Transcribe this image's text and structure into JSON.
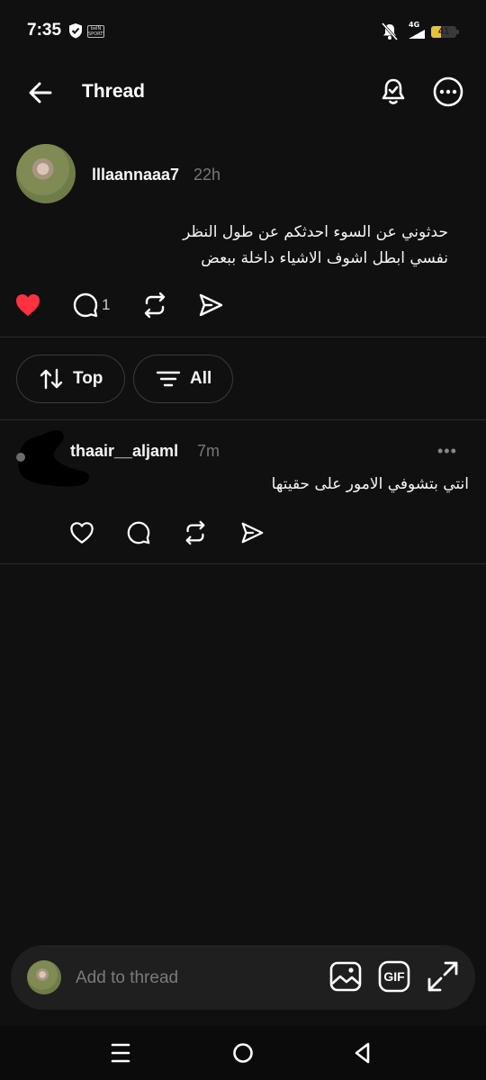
{
  "status_bar": {
    "time": "7:35",
    "app_badge": "beIN SPORTS",
    "network": "4G",
    "battery_level": "41",
    "battery_percent": 41,
    "battery_color": "#e7c13a"
  },
  "header": {
    "title": "Thread"
  },
  "post": {
    "username": "lllaannaaa7",
    "time": "22h",
    "text_line1": "حدثوني عن السوء احدثكم عن طول النظر",
    "text_line2": "نفسي ابطل اشوف الاشياء داخلة ببعض",
    "liked": true,
    "like_color": "#ff3040",
    "comment_count": "1"
  },
  "filters": {
    "sort_label": "Top",
    "filter_label": "All"
  },
  "reply": {
    "username": "thaair__aljaml",
    "time": "7m",
    "more_label": "•••",
    "text": "انتي بتشوفي الامور على حقيتها"
  },
  "composer": {
    "placeholder": "Add to thread",
    "gif_label": "GIF"
  },
  "icons": {
    "back": "arrow-left-icon",
    "notify": "bell-icon",
    "more": "more-horizontal-icon",
    "like": "heart-icon",
    "comment": "comment-icon",
    "repost": "repost-icon",
    "share": "send-icon",
    "sort": "sort-arrows-icon",
    "filter": "filter-lines-icon",
    "image": "image-icon",
    "gif": "gif-icon",
    "expand": "expand-icon"
  }
}
